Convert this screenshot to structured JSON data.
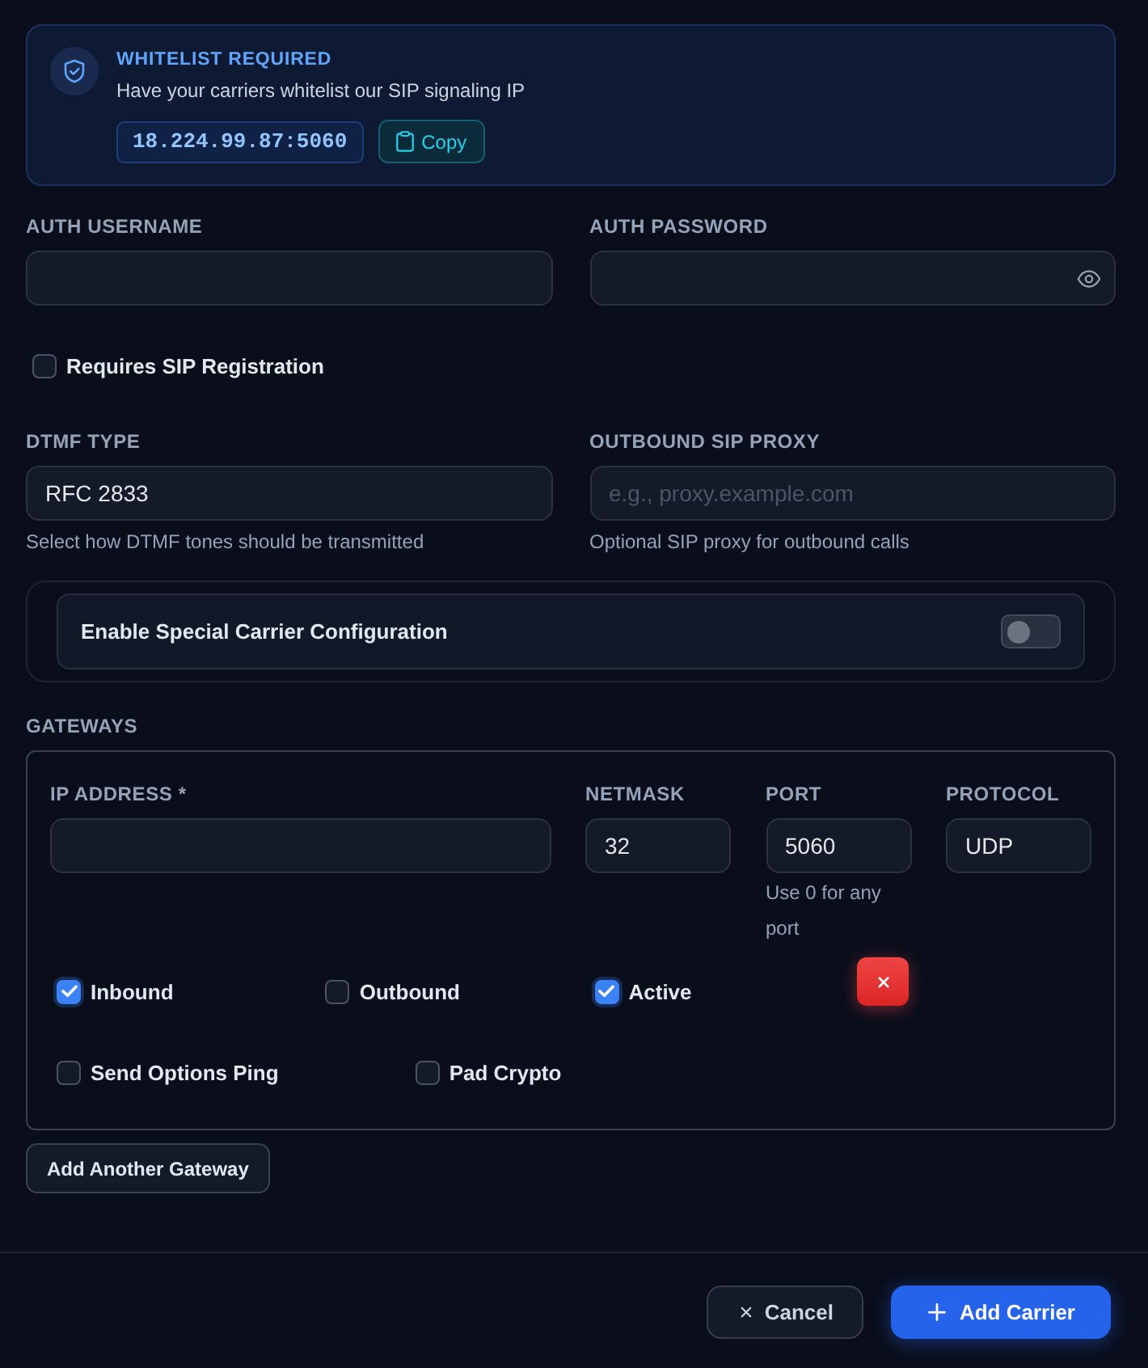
{
  "whitelist": {
    "title": "WHITELIST REQUIRED",
    "message": "Have your carriers whitelist our SIP signaling IP",
    "address": "18.224.99.87:5060",
    "copy_label": "Copy"
  },
  "auth_fields": [
    {
      "label": "AUTH USERNAME",
      "kind": "text"
    },
    {
      "label": "AUTH PASSWORD",
      "kind": "password"
    }
  ],
  "registration": {
    "label": "Requires SIP Registration",
    "checked": false
  },
  "sip_fields": [
    {
      "label": "DTMF TYPE",
      "value": "RFC 2833",
      "hint": "Select how DTMF tones should be transmitted"
    },
    {
      "label": "OUTBOUND SIP PROXY",
      "placeholder": "e.g., proxy.example.com",
      "hint": "Optional SIP proxy for outbound calls"
    }
  ],
  "special_config": {
    "label": "Enable Special Carrier Configuration",
    "on": false
  },
  "gateways": {
    "label": "GATEWAYS",
    "items": [
      {
        "fields": [
          {
            "label": "IP ADDRESS *"
          },
          {
            "label": "NETMASK",
            "value": "32"
          },
          {
            "label": "PORT",
            "value": "5060",
            "hint": "Use 0 for any port"
          },
          {
            "label": "PROTOCOL",
            "value": "UDP"
          }
        ],
        "flags": [
          {
            "label": "Inbound",
            "checked": true
          },
          {
            "label": "Outbound",
            "checked": false
          },
          {
            "label": "Active",
            "checked": true
          }
        ],
        "options": [
          {
            "label": "Send Options Ping",
            "checked": false
          },
          {
            "label": "Pad Crypto",
            "checked": false
          }
        ]
      }
    ],
    "add_label": "Add Another Gateway"
  },
  "actions": [
    {
      "label": "Cancel",
      "kind": "secondary"
    },
    {
      "label": "Add Carrier",
      "kind": "primary"
    }
  ]
}
